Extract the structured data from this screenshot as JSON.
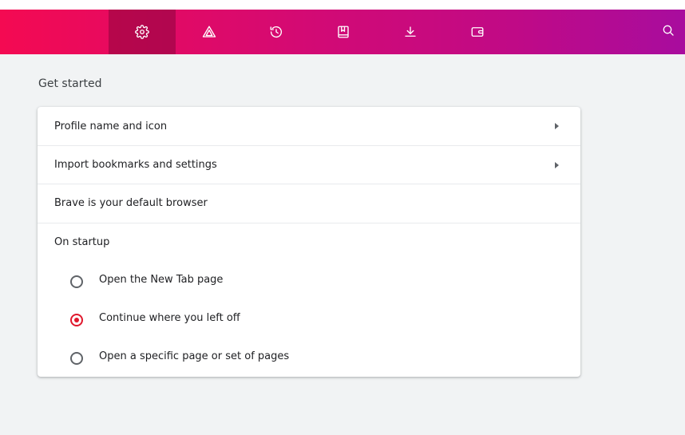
{
  "toolbar": {
    "tabs": [
      {
        "icon": "gear-icon",
        "active": true
      },
      {
        "icon": "brave-shields-icon",
        "active": false
      },
      {
        "icon": "history-icon",
        "active": false
      },
      {
        "icon": "bookmarks-icon",
        "active": false
      },
      {
        "icon": "downloads-icon",
        "active": false
      },
      {
        "icon": "wallet-icon",
        "active": false
      }
    ],
    "search_icon": "search-icon",
    "gradient_colors": [
      "#f40a52",
      "#d30a74",
      "#c00a86",
      "#a80c9e"
    ]
  },
  "section": {
    "title": "Get started"
  },
  "rows": {
    "profile": "Profile name and icon",
    "import": "Import bookmarks and settings",
    "default_browser": "Brave is your default browser",
    "startup_label": "On startup"
  },
  "startup_options": [
    {
      "label": "Open the New Tab page",
      "checked": false
    },
    {
      "label": "Continue where you left off",
      "checked": true
    },
    {
      "label": "Open a specific page or set of pages",
      "checked": false
    }
  ],
  "colors": {
    "accent": "#e0182d",
    "background": "#f1f3f4",
    "card": "#ffffff"
  }
}
